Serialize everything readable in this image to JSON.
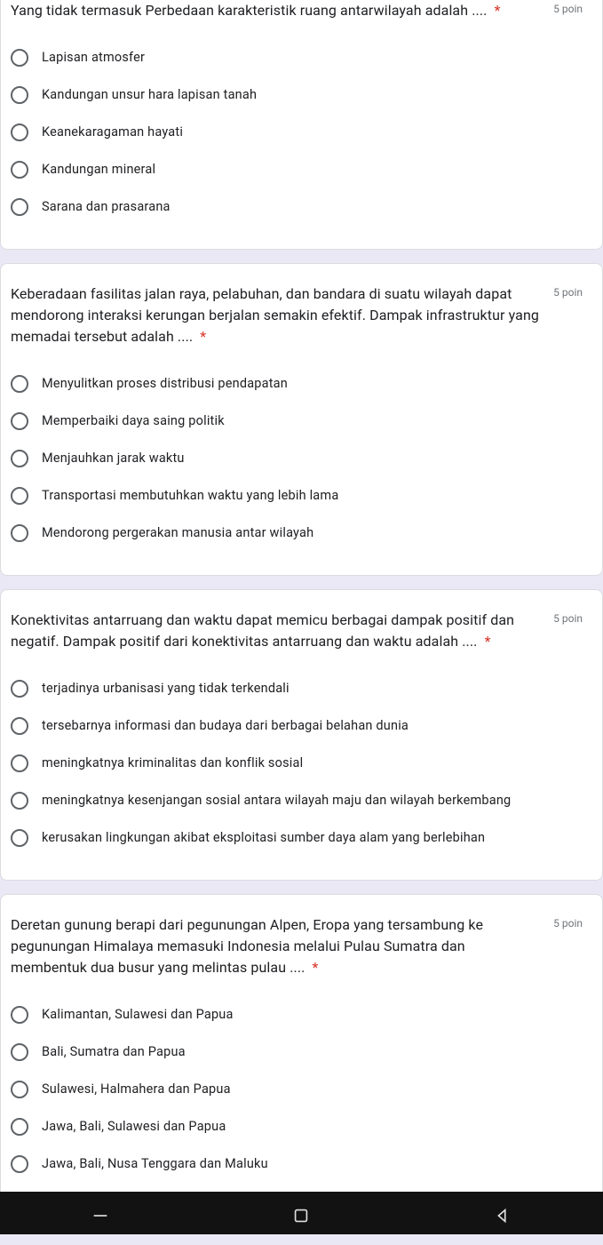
{
  "points_label": "5 poin",
  "questions": [
    {
      "text": "Yang tidak termasuk Perbedaan karakteristik ruang antarwilayah adalah ....",
      "options": [
        "Lapisan atmosfer",
        "Kandungan unsur hara lapisan tanah",
        "Keanekaragaman hayati",
        "Kandungan mineral",
        "Sarana dan prasarana"
      ]
    },
    {
      "text": "Keberadaan fasilitas jalan raya, pelabuhan, dan bandara di suatu wilayah dapat mendorong interaksi kerungan berjalan semakin efektif. Dampak infrastruktur yang memadai tersebut adalah ....",
      "options": [
        "Menyulitkan proses distribusi pendapatan",
        "Memperbaiki daya saing politik",
        "Menjauhkan jarak waktu",
        "Transportasi membutuhkan waktu yang lebih lama",
        "Mendorong pergerakan manusia antar wilayah"
      ]
    },
    {
      "text": "Konektivitas antarruang dan waktu dapat memicu berbagai dampak positif dan negatif. Dampak positif dari konektivitas antarruang dan waktu adalah ....",
      "options": [
        "terjadinya urbanisasi yang tidak terkendali",
        "tersebarnya informasi dan budaya dari berbagai belahan dunia",
        "meningkatnya kriminalitas dan konflik sosial",
        "meningkatnya kesenjangan sosial antara wilayah maju dan wilayah berkembang",
        "kerusakan lingkungan akibat eksploitasi sumber daya alam yang berlebihan"
      ]
    },
    {
      "text": "Deretan gunung berapi dari pegunungan Alpen, Eropa yang tersambung ke pegunungan Himalaya memasuki Indonesia melalui Pulau Sumatra dan membentuk dua busur yang melintas pulau ....",
      "options": [
        "Kalimantan, Sulawesi dan Papua",
        "Bali, Sumatra dan Papua",
        "Sulawesi, Halmahera dan Papua",
        "Jawa, Bali, Sulawesi dan Papua",
        "Jawa, Bali, Nusa Tenggara dan Maluku"
      ]
    }
  ]
}
